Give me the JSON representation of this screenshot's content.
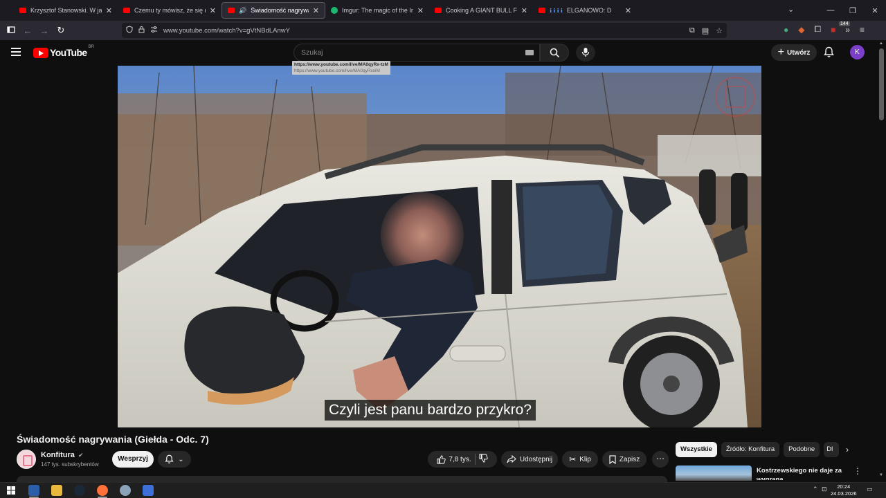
{
  "browser": {
    "tabs": [
      {
        "title": "Krzysztof Stanowski. W jakiej sp",
        "favicon": "youtube-icon",
        "active": false
      },
      {
        "title": "Czemu ty mówisz, że się na cieb",
        "favicon": "youtube-icon",
        "active": false
      },
      {
        "title": "Świadomość nagrywania (G",
        "favicon": "youtube-icon",
        "active": true,
        "audio": true
      },
      {
        "title": "Imgur: The magic of the Interne",
        "favicon": "imgur-icon",
        "active": false
      },
      {
        "title": "Cooking A GIANT BULL For A G",
        "favicon": "youtube-icon",
        "active": false
      },
      {
        "title": "ELGANOWO: D",
        "prefix": "ℹ ℹ ℹ ℹ",
        "favicon": "youtube-icon",
        "active": false
      }
    ],
    "url": "www.youtube.com/watch?v=gVtNBdLAnwY",
    "extension_badge": "144",
    "link_tooltip_1": "https://www.youtube.com/live/MA0qyRx-tzM",
    "link_tooltip_2": "https://www.youtube.com/live/MA0qyRxxiM"
  },
  "youtube": {
    "logo_text": "YouTube",
    "country_code": "BR",
    "search_placeholder": "Szukaj",
    "create_label": "Utwórz",
    "avatar_letter": "K"
  },
  "video": {
    "subtitle": "Czyli jest panu bardzo przykro?",
    "title": "Świadomość nagrywania (Giełda - Odc. 7)",
    "channel_name": "Konfitura",
    "subscribers": "147 tys. subskrybentów",
    "support_label": "Wesprzyj",
    "likes": "7,8 tys.",
    "share_label": "Udostępnij",
    "clip_label": "Klip",
    "save_label": "Zapisz"
  },
  "recommendations": {
    "chips": [
      "Wszystkie",
      "Źródło: Konfitura",
      "Podobne",
      "Dl"
    ],
    "first_title": "Kostrzewskiego nie daje za wygrana"
  },
  "taskbar": {
    "time": "20:24",
    "date": "24.03.2026"
  },
  "colors": {
    "accent_red": "#ff0000",
    "background": "#0f0f0f",
    "avatar": "#7b3fc9"
  }
}
